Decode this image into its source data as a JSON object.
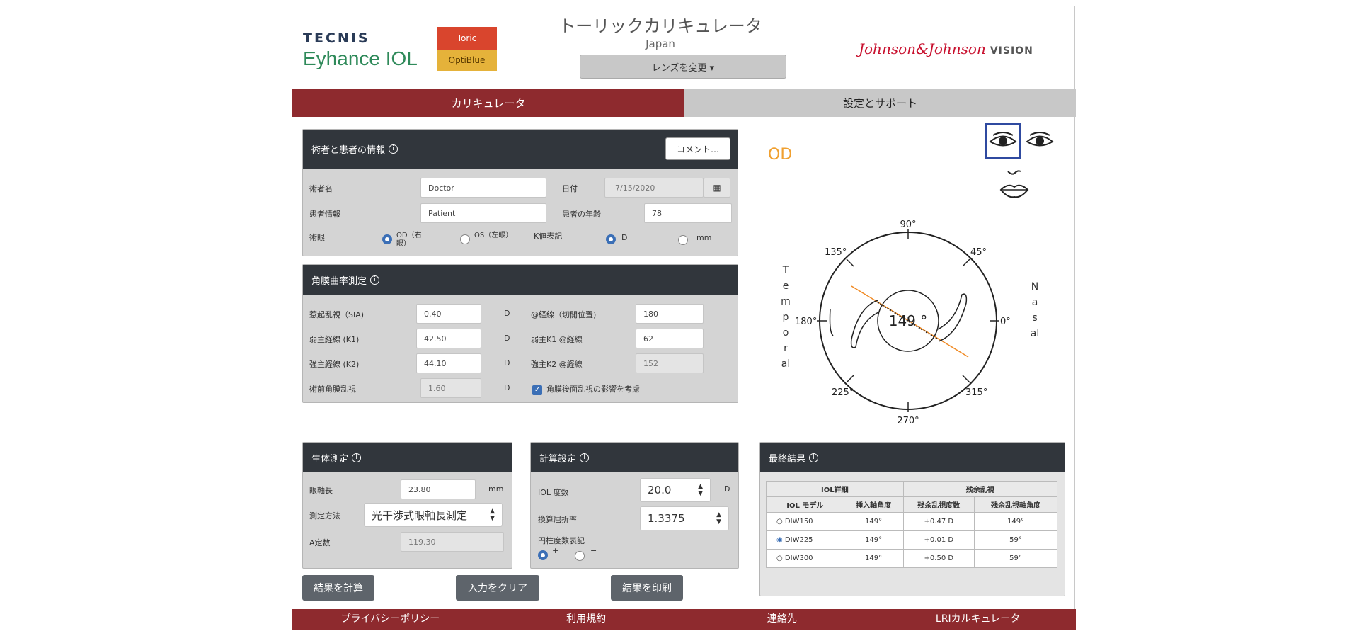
{
  "header": {
    "brand_top": "TECNIS",
    "brand_main": "Eyhance IOL",
    "tag_toric": "Toric",
    "tag_optiblue": "OptiBlue",
    "title": "トーリックカリキュレータ",
    "region": "Japan",
    "change_lens": "レンズを変更 ▾",
    "company": "Johnson&Johnson",
    "company_suffix": "VISION"
  },
  "tabs": [
    {
      "label": "カリキュレータ",
      "active": true
    },
    {
      "label": "設定とサポート",
      "active": false
    }
  ],
  "surgeon_panel": {
    "title": "術者と患者の情報",
    "comment_button": "コメント…",
    "surgeon_label": "術者名",
    "surgeon_value": "Doctor",
    "date_label": "日付",
    "date_value": "7/15/2020",
    "patient_label": "患者情報",
    "patient_value": "Patient",
    "age_label": "患者の年齢",
    "age_value": "78",
    "eye_label": "術眼",
    "od_label": "OD（右眼）",
    "os_label": "OS（左眼）",
    "k_label": "K値表記",
    "k_d": "D",
    "k_mm": "mm",
    "selected_eye": "OD",
    "selected_k": "D"
  },
  "keratometry_panel": {
    "title": "角膜曲率測定",
    "sia_label": "惹起乱視（SIA)",
    "sia_value": "0.40",
    "k1_label": "弱主経線 (K1)",
    "k1_value": "42.50",
    "k2_label": "強主経線 (K2)",
    "k2_value": "44.10",
    "preop_label": "術前角膜乱視",
    "preop_value": "1.60",
    "unit": "D",
    "incision_label": "@経線（切開位置)",
    "incision_value": "180",
    "k1_axis_label": "弱主K1 @経線",
    "k1_axis_value": "62",
    "k2_axis_label": "強主K2 @経線",
    "k2_axis_value": "152",
    "posterior_label": "角膜後面乱視の影響を考慮",
    "posterior_checked": true
  },
  "biometry_panel": {
    "title": "生体測定",
    "axial_label": "眼軸長",
    "axial_value": "23.80",
    "axial_unit": "mm",
    "method_label": "測定方法",
    "method_value": "光干渉式眼軸長測定",
    "aconst_label": "A定数",
    "aconst_value": "119.30"
  },
  "calc_panel": {
    "title": "計算設定",
    "iol_power_label": "IOL 度数",
    "iol_power_value": "20.0",
    "iol_power_unit": "D",
    "index_label": "換算屈折率",
    "index_value": "1.3375",
    "cyl_label": "円柱度数表記",
    "plus": "+",
    "minus": "−",
    "selected_cyl": "+"
  },
  "results_panel": {
    "title": "最終結果",
    "group1": "IOL詳細",
    "group2": "残余乱視",
    "columns": [
      "IOL モデル",
      "挿入軸角度",
      "残余乱視度数",
      "残余乱視軸角度"
    ],
    "rows": [
      {
        "model": "DIW150",
        "axis": "149°",
        "residual": "+0.47 D",
        "residual_axis": "149°",
        "selected": false
      },
      {
        "model": "DIW225",
        "axis": "149°",
        "residual": "+0.01 D",
        "residual_axis": "59°",
        "selected": true
      },
      {
        "model": "DIW300",
        "axis": "149°",
        "residual": "+0.50 D",
        "residual_axis": "59°",
        "selected": false
      }
    ]
  },
  "diagram": {
    "eye": "OD",
    "center_angle": "149 °",
    "deg_90": "90°",
    "deg_45": "45°",
    "deg_135": "135°",
    "deg_180": "180°",
    "deg_0": "0°",
    "deg_225": "225°",
    "deg_315": "315°",
    "deg_270": "270°",
    "temporal": "Temporal",
    "nasal": "Nasal"
  },
  "actions": {
    "calculate": "結果を計算",
    "clear": "入力をクリア",
    "print": "結果を印刷"
  },
  "footer": [
    "プライバシーポリシー",
    "利用規約",
    "連絡先",
    "LRIカルキュレータ"
  ]
}
